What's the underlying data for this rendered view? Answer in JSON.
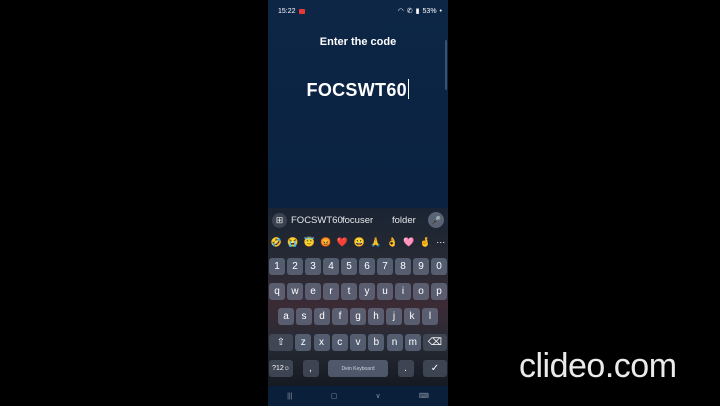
{
  "status_bar": {
    "time": "15:22",
    "battery": "53%",
    "icons": [
      "wifi-icon",
      "call-icon",
      "signal-icon"
    ]
  },
  "screen": {
    "title": "Enter the code",
    "code_value": "FOCSWT60"
  },
  "keyboard": {
    "suggestions": [
      "FOCSWT60",
      "focuser",
      "folder"
    ],
    "emojis": [
      "🤣",
      "😭",
      "😇",
      "😡",
      "❤️",
      "😀",
      "🙏",
      "👌",
      "🩷",
      "🤞",
      "⋯"
    ],
    "row_numbers": [
      "1",
      "2",
      "3",
      "4",
      "5",
      "6",
      "7",
      "8",
      "9",
      "0"
    ],
    "row_qwerty": [
      "q",
      "w",
      "e",
      "r",
      "t",
      "y",
      "u",
      "i",
      "o",
      "p"
    ],
    "row_asdf": [
      "a",
      "s",
      "d",
      "f",
      "g",
      "h",
      "j",
      "k",
      "l"
    ],
    "row_zxcv": [
      "z",
      "x",
      "c",
      "v",
      "b",
      "n",
      "m"
    ],
    "shift_label": "⇧",
    "backspace_label": "⌫",
    "symbols_label": "?12",
    "emoji_key": "☺",
    "comma_label": ",",
    "space_label": "Dein Keyboard",
    "period_label": ".",
    "enter_label": "✓"
  },
  "watermark": "clideo.com"
}
